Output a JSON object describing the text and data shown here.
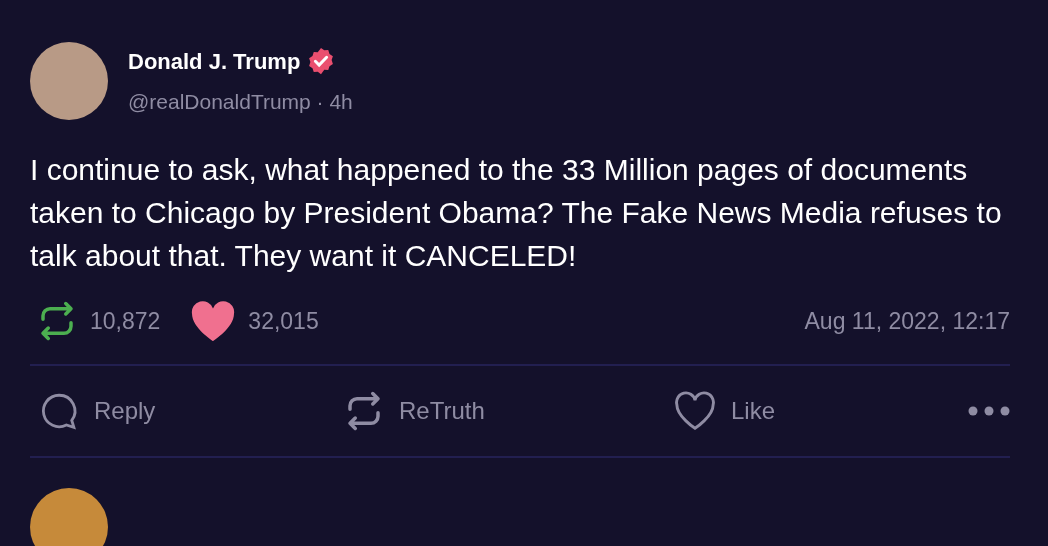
{
  "post": {
    "author": {
      "name": "Donald J. Trump",
      "verified": true,
      "handle": "@realDonaldTrump",
      "separator": "·",
      "age": "4h"
    },
    "text": "I continue to ask, what happened to the 33 Million pages of documents taken to Chicago by President Obama? The Fake News Media refuses to talk about that. They want it CANCELED!",
    "stats": {
      "retruths": "10,872",
      "likes": "32,015",
      "timestamp": "Aug 11, 2022, 12:17"
    },
    "actions": [
      {
        "kind": "reply",
        "label": "Reply"
      },
      {
        "kind": "retruth",
        "label": "ReTruth"
      },
      {
        "kind": "like",
        "label": "Like"
      },
      {
        "kind": "more"
      }
    ]
  }
}
